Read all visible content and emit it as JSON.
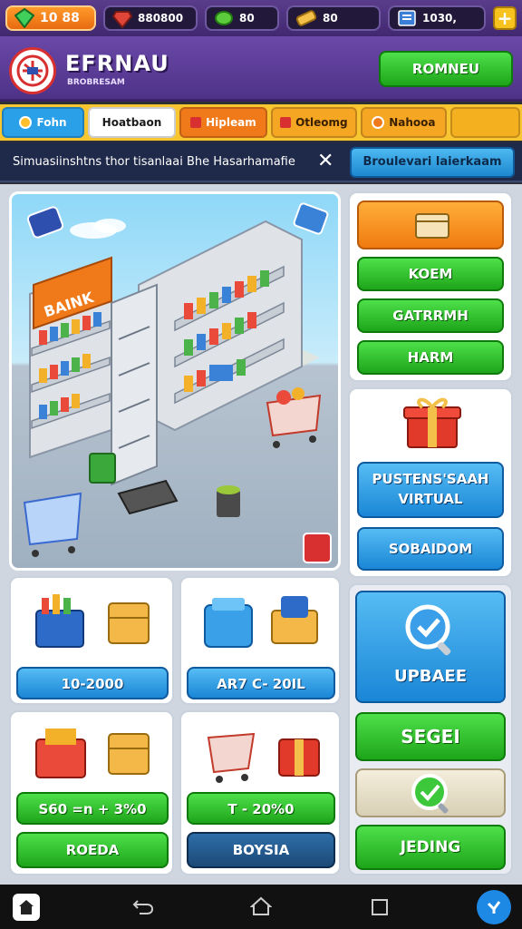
{
  "topbar": {
    "resource_a": "10 88",
    "resource_b": "880800",
    "resource_c": "80",
    "resource_d": "80",
    "resource_e": "1030,",
    "add_label": "+"
  },
  "header": {
    "brand": "EFRNAU",
    "brand_sub": "BROBRESAM",
    "button": "ROMNEU"
  },
  "tabs": [
    {
      "label": "Fohn",
      "color": "#2aa0e8",
      "text_color": "#ffffff"
    },
    {
      "label": "Hoatbaon",
      "color": "#ffffff",
      "text_color": "#1a1a1a"
    },
    {
      "label": "Hipleam",
      "color": "#f07a1a",
      "text_color": "#ffffff"
    },
    {
      "label": "Otleomg",
      "color": "#f5a623",
      "text_color": "#3a2000"
    },
    {
      "label": "Nahooa",
      "color": "#f5a623",
      "text_color": "#3a2000"
    },
    {
      "label": "",
      "color": "#f5b020",
      "text_color": "#3a2000"
    }
  ],
  "notice": {
    "text": "Simuasiinshtns thor tisanlaai Bhe Hasarhamafie",
    "button": "Broulevari laierkaam"
  },
  "side_menu": {
    "items": [
      "KOEM",
      "GATRRMH",
      "HARM"
    ]
  },
  "promo": {
    "title": "PUSTENS'SAAH VIRTUAL",
    "button": "SOBAIDOM"
  },
  "shop": [
    {
      "price": "10-2000",
      "button": "",
      "price_style": "blue"
    },
    {
      "price": "AR7 C- 20IL",
      "button": "",
      "price_style": "blue"
    },
    {
      "price": "S60 =n + 3%0",
      "button": "ROEDA",
      "price_style": "green"
    },
    {
      "price": "T - 20%0",
      "button": "BOYSIA",
      "price_style": "green"
    }
  ],
  "upgrade": {
    "label": "UPBAEE",
    "segei": "SEGEI",
    "jeding": "JEDING"
  },
  "scene": {
    "sign_text": "BAINK"
  },
  "colors": {
    "green": "#1ea51a",
    "orange": "#f07a10",
    "blue": "#1a86d6",
    "purple": "#4e3288",
    "yellow": "#f7c630"
  },
  "icons": [
    "gem-icon",
    "ruby-icon",
    "leaf-icon",
    "gold-bar-icon",
    "trophy-icon",
    "plus-icon",
    "home-icon",
    "back-icon",
    "recents-icon",
    "assistant-icon"
  ]
}
